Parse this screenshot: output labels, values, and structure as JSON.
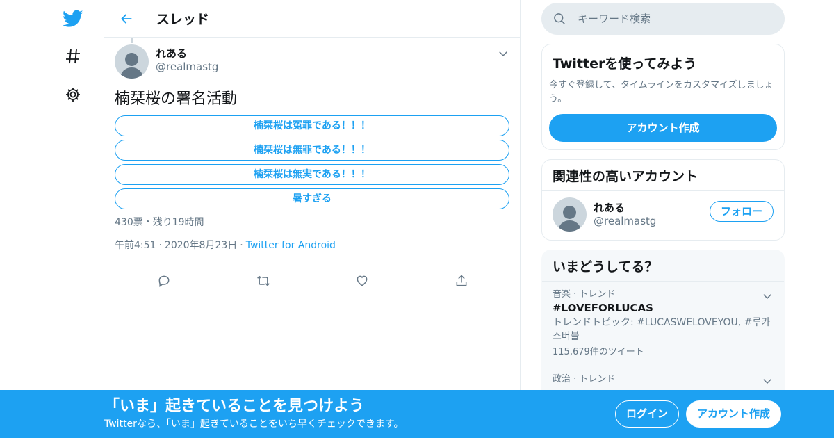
{
  "nav": {
    "items": [
      {
        "icon": "twitter-bird-icon"
      },
      {
        "icon": "hashtag-icon"
      },
      {
        "icon": "gear-icon"
      }
    ]
  },
  "header": {
    "title": "スレッド",
    "back_icon": "back-arrow-icon"
  },
  "tweet": {
    "display_name": "れある",
    "handle": "@realmastg",
    "text": "楠栞桜の署名活動",
    "poll": {
      "options": [
        "楠栞桜は冤罪である！！！",
        "楠栞桜は無罪である！！！",
        "楠栞桜は無実である！！！",
        "暑すぎる"
      ],
      "meta": "430票・残り19時間"
    },
    "time": "午前4:51",
    "date": "2020年8月23日",
    "separator": "·",
    "source": "Twitter for Android",
    "actions": [
      "reply-icon",
      "retweet-icon",
      "like-icon",
      "share-icon"
    ]
  },
  "search": {
    "placeholder": "キーワード検索"
  },
  "signup_card": {
    "title": "Twitterを使ってみよう",
    "text": "今すぐ登録して、タイムラインをカスタマイズしましょう。",
    "button": "アカウント作成"
  },
  "related_card": {
    "title": "関連性の高いアカウント",
    "account": {
      "display_name": "れある",
      "handle": "@realmastg",
      "follow_label": "フォロー"
    }
  },
  "trends_card": {
    "title": "いまどうしてる？",
    "items": [
      {
        "context": "音楽 · トレンド",
        "name": "#LOVEFORLUCAS",
        "desc": "トレンドトピック: #LUCASWELOVEYOU, #루카스버블",
        "count": "115,679件のツイート"
      },
      {
        "context": "政治 · トレンド",
        "name": "",
        "desc": "",
        "count": ""
      }
    ]
  },
  "banner": {
    "title": "「いま」起きていることを見つけよう",
    "subtitle": "Twitterなら、「いま」起きていることをいち早くチェックできます。",
    "login": "ログイン",
    "signup": "アカウント作成"
  },
  "colors": {
    "accent": "#1da1f2",
    "secondary_text": "#657786",
    "border": "#e6ecf0"
  }
}
